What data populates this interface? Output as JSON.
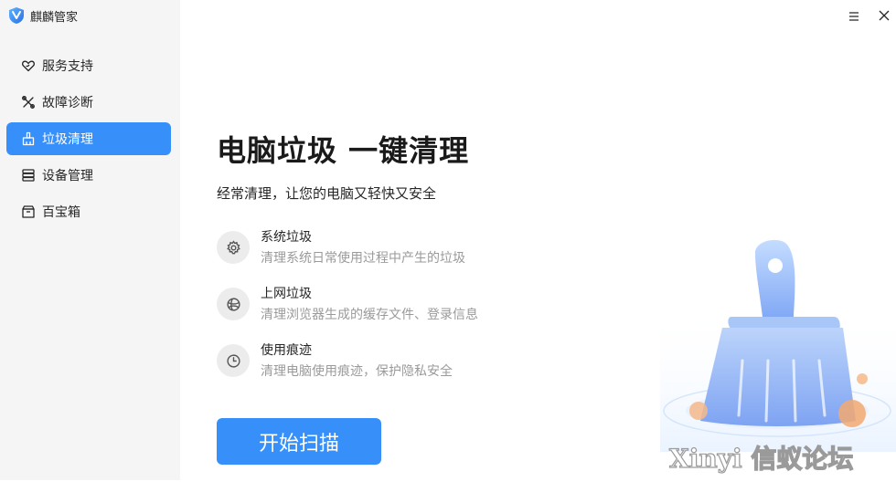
{
  "app": {
    "title": "麒麟管家"
  },
  "sidebar": {
    "items": [
      {
        "label": "服务支持",
        "icon": "heart-hand-icon",
        "active": false
      },
      {
        "label": "故障诊断",
        "icon": "tools-icon",
        "active": false
      },
      {
        "label": "垃圾清理",
        "icon": "broom-icon",
        "active": true
      },
      {
        "label": "设备管理",
        "icon": "device-stack-icon",
        "active": false
      },
      {
        "label": "百宝箱",
        "icon": "toolbox-icon",
        "active": false
      }
    ]
  },
  "window_controls": {
    "menu_icon": "hamburger-menu-icon",
    "close_icon": "close-icon"
  },
  "main": {
    "title": "电脑垃圾 一键清理",
    "subtitle": "经常清理，让您的电脑又轻快又安全",
    "features": [
      {
        "title": "系统垃圾",
        "desc": "清理系统日常使用过程中产生的垃圾",
        "icon": "gear-icon"
      },
      {
        "title": "上网垃圾",
        "desc": "清理浏览器生成的缓存文件、登录信息",
        "icon": "globe-icon"
      },
      {
        "title": "使用痕迹",
        "desc": "清理电脑使用痕迹，保护隐私安全",
        "icon": "clock-icon"
      }
    ],
    "scan_button": "开始扫描"
  },
  "watermark": "Xinyi 信蚁论坛",
  "colors": {
    "accent": "#3790fa",
    "sidebar_bg": "#f5f5f5",
    "muted_text": "#9a9a9a"
  }
}
